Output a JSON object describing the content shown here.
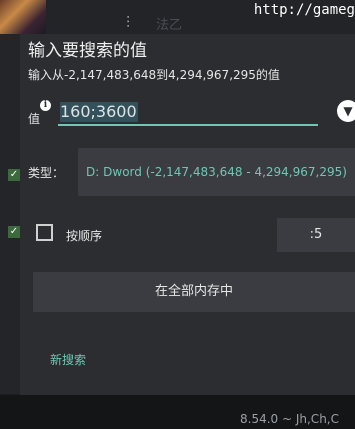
{
  "background": {
    "url_text": "http://gameg",
    "ghost_title": "法乙",
    "version_text": "8.54.0 ~ Jh,Ch,C"
  },
  "dialog": {
    "title": "输入要搜索的值",
    "subtitle": "输入从-2,147,483,648到4,294,967,295的值",
    "value_label": "值",
    "value": "160;3600",
    "type_label": "类型：",
    "type_value": "D: Dword (-2,147,483,648 - 4,294,967,295)",
    "order_label": "按顺序",
    "order_checked": false,
    "step_value": ":5",
    "memory_button": "在全部内存中",
    "new_search": "新搜索"
  },
  "icons": {
    "info": "info-icon",
    "dropdown": "dropdown-arrow-icon",
    "filter": "filter-icon"
  },
  "colors": {
    "accent": "#6fc7b4",
    "dialog_bg": "#2b2d31",
    "button_bg": "#3a3c41"
  }
}
